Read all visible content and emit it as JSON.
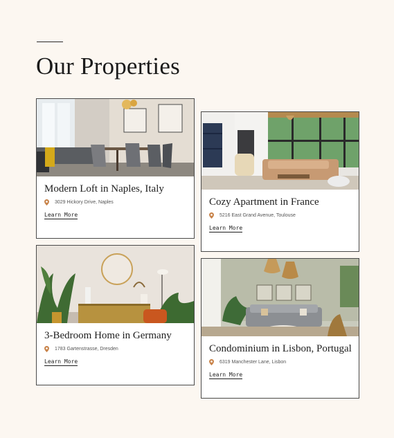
{
  "section": {
    "title": "Our Properties"
  },
  "properties": [
    {
      "title": "Modern Loft in Naples, Italy",
      "address": "3029 Hickory Drive, Naples",
      "link_label": "Learn More",
      "photo_icon": "dining-room-photo"
    },
    {
      "title": "Cozy Apartment in France",
      "address": "5216 East Grand Avenue, Toulouse",
      "link_label": "Learn More",
      "photo_icon": "living-room-photo"
    },
    {
      "title": "3-Bedroom Home in Germany",
      "address": "1783 Gartenstrasse, Dresden",
      "link_label": "Learn More",
      "photo_icon": "sideboard-plants-photo"
    },
    {
      "title": "Condominium in Lisbon, Portugal",
      "address": "6319 Manchester Lane, Lisbon",
      "link_label": "Learn More",
      "photo_icon": "lounge-photo"
    }
  ],
  "colors": {
    "page_background": "#fcf7f1",
    "card_border": "#4a4a4a",
    "pin_accent": "#c8834a",
    "text": "#1e1e1e"
  }
}
